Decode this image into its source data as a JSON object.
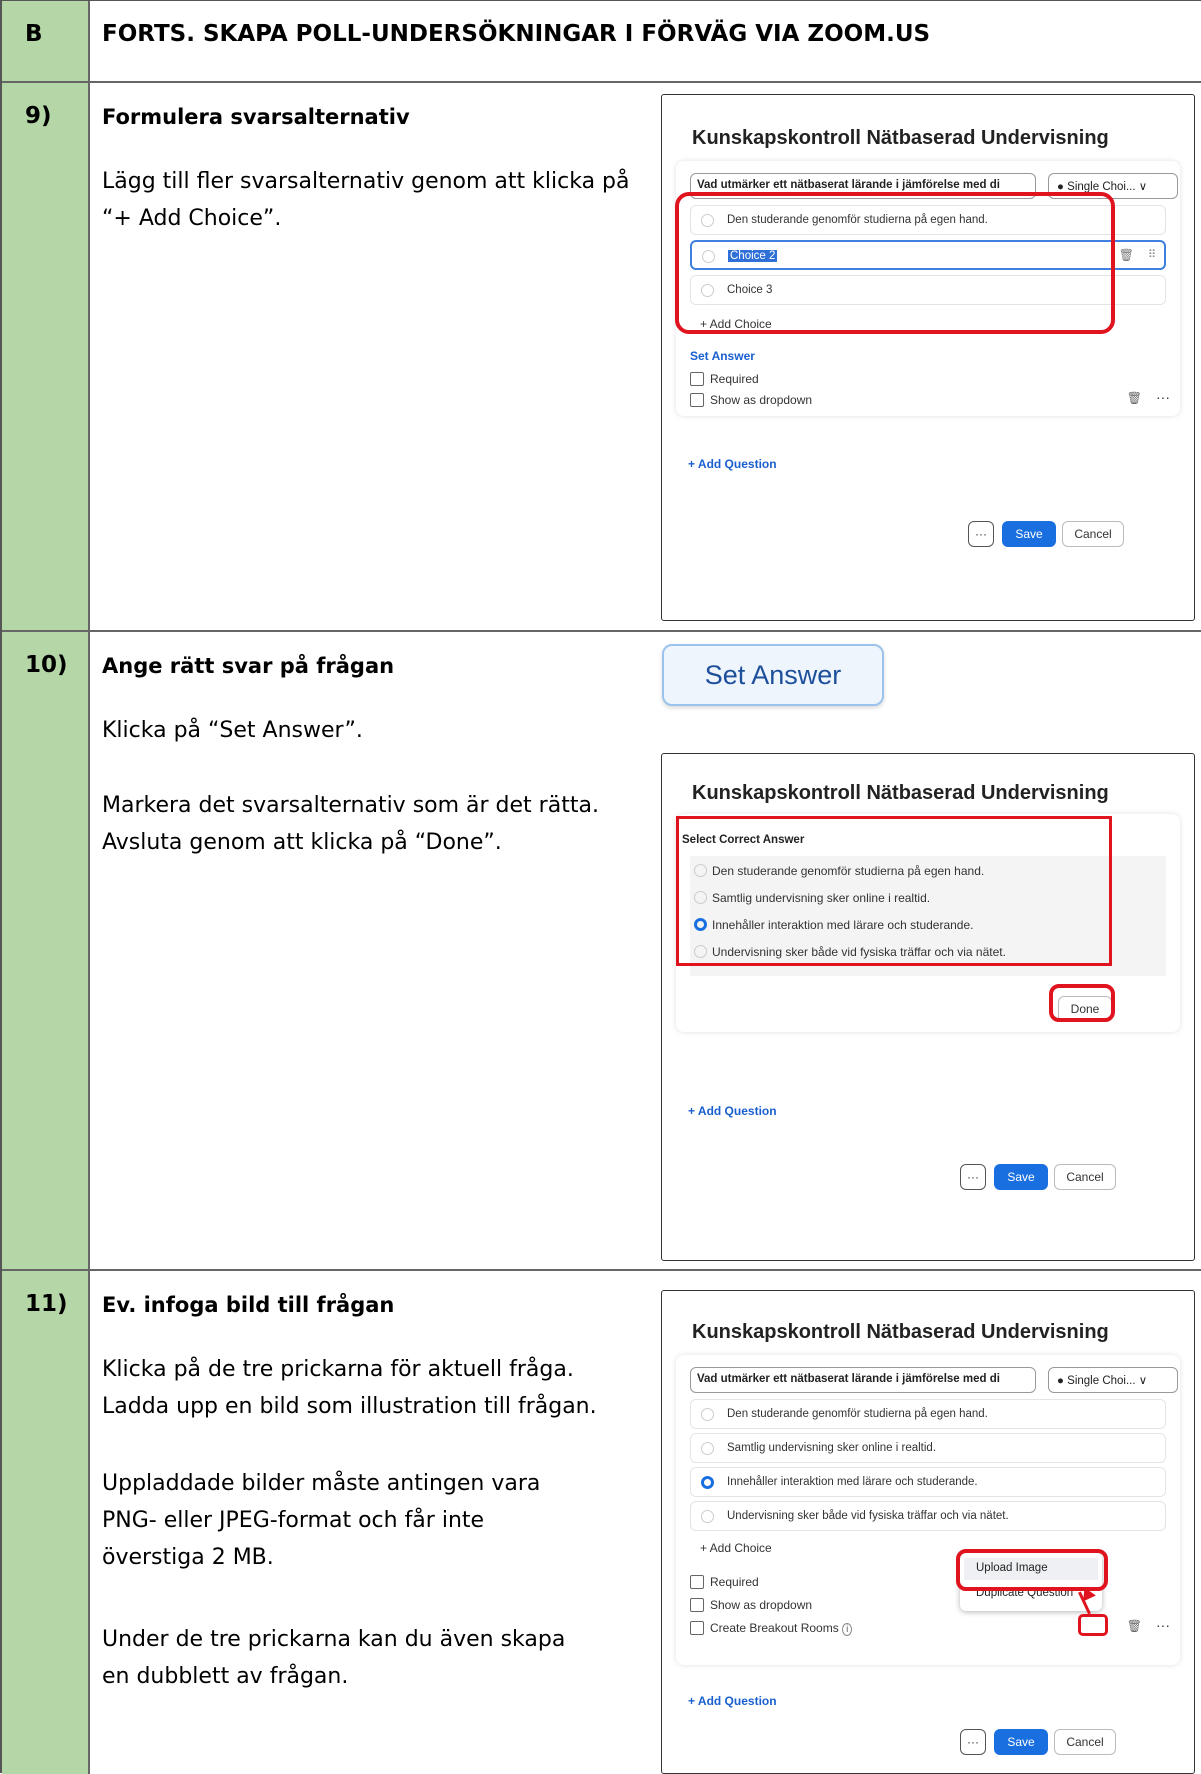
{
  "header": {
    "col_a": "B",
    "title": "FORTS. SKAPA POLL-UNDERSÖKNINGAR I FÖRVÄG VIA ZOOM.US"
  },
  "step9": {
    "num": "9)",
    "title": "Formulera svarsalternativ",
    "text": "Lägg till fler svarsalternativ genom att klicka på “+ Add Choice”.",
    "shot": {
      "title": "Kunskapskontroll Nätbaserad Undervisning",
      "question": "Vad utmärker ett nätbaserat lärande i jämförelse med di",
      "type": "Single Choi... ∨",
      "choices": [
        "Den studerande genomför studierna på egen hand.",
        "Choice 2",
        "Choice 3"
      ],
      "add_choice": "+  Add Choice",
      "set_answer": "Set Answer",
      "required": "Required",
      "dropdown": "Show as dropdown",
      "add_question": "+  Add Question",
      "more": "···",
      "save": "Save",
      "cancel": "Cancel"
    }
  },
  "step10": {
    "num": "10)",
    "title": "Ange rätt svar på frågan",
    "text1": "Klicka på “Set Answer”.",
    "text2": "Markera det svarsalternativ som är det rätta. Avsluta genom att klicka på “Done”.",
    "button_zoom": "Set Answer",
    "shot": {
      "title": "Kunskapskontroll Nätbaserad Undervisning",
      "select_label": "Select Correct Answer",
      "options": [
        "Den studerande genomför studierna på egen hand.",
        "Samtlig undervisning sker online i realtid.",
        "Innehåller interaktion med lärare och studerande.",
        "Undervisning sker både vid fysiska träffar och via nätet."
      ],
      "selected_index": 2,
      "done": "Done",
      "add_question": "+  Add Question",
      "more": "···",
      "save": "Save",
      "cancel": "Cancel"
    }
  },
  "step11": {
    "num": "11)",
    "title": "Ev. infoga bild till frågan",
    "text1": "Klicka på de tre prickarna för aktuell fråga. Ladda upp en bild som illustration till frågan.",
    "text2": "Uppladdade bilder måste antingen vara PNG- eller JPEG-format och får inte överstiga 2 MB.",
    "text3": "Under de tre prickarna kan du även skapa en dubblett av frågan.",
    "shot": {
      "title": "Kunskapskontroll Nätbaserad Undervisning",
      "question": "Vad utmärker ett nätbaserat lärande i jämförelse med di",
      "type": "Single Choi... ∨",
      "choices": [
        "Den studerande genomför studierna på egen hand.",
        "Samtlig undervisning sker online i realtid.",
        "Innehåller interaktion med lärare och studerande.",
        "Undervisning sker både vid fysiska träffar och via nätet."
      ],
      "selected_index": 2,
      "add_choice": "+  Add Choice",
      "required": "Required",
      "dropdown": "Show as dropdown",
      "breakout": "Create Breakout Rooms",
      "menu": [
        "Upload Image",
        "Duplicate Question"
      ],
      "add_question": "+  Add Question",
      "more": "···",
      "save": "Save",
      "cancel": "Cancel"
    }
  }
}
